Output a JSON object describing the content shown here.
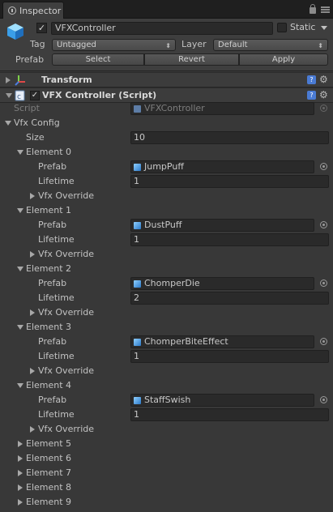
{
  "tab": {
    "label": "Inspector"
  },
  "header": {
    "object_name": "VFXController",
    "static_label": "Static",
    "tag_label": "Tag",
    "tag_value": "Untagged",
    "layer_label": "Layer",
    "layer_value": "Default",
    "prefab_label": "Prefab",
    "prefab_buttons": {
      "select": "Select",
      "revert": "Revert",
      "apply": "Apply"
    }
  },
  "components": {
    "transform": {
      "title": "Transform"
    },
    "script": {
      "title": "VFX Controller (Script)"
    }
  },
  "script_field": {
    "label": "Script",
    "value": "VFXController"
  },
  "vfx_config": {
    "label": "Vfx Config",
    "size_label": "Size",
    "size_value": "10",
    "prop_prefab": "Prefab",
    "prop_lifetime": "Lifetime",
    "prop_override": "Vfx Override",
    "elements": [
      {
        "label": "Element 0",
        "prefab": "JumpPuff",
        "lifetime": "1"
      },
      {
        "label": "Element 1",
        "prefab": "DustPuff",
        "lifetime": "1"
      },
      {
        "label": "Element 2",
        "prefab": "ChomperDie",
        "lifetime": "2"
      },
      {
        "label": "Element 3",
        "prefab": "ChomperBiteEffect",
        "lifetime": "1"
      },
      {
        "label": "Element 4",
        "prefab": "StaffSwish",
        "lifetime": "1"
      },
      {
        "label": "Element 5"
      },
      {
        "label": "Element 6"
      },
      {
        "label": "Element 7"
      },
      {
        "label": "Element 8"
      },
      {
        "label": "Element 9"
      }
    ]
  },
  "icons": {
    "gameobject": "cube-icon",
    "transform": "transform-axes-icon",
    "script": "script-icon",
    "help": "help-icon",
    "settings": "gear-icon"
  },
  "colors": {
    "background": "#383838",
    "field": "#2a2a2a",
    "accent": "#4a7bd4"
  }
}
